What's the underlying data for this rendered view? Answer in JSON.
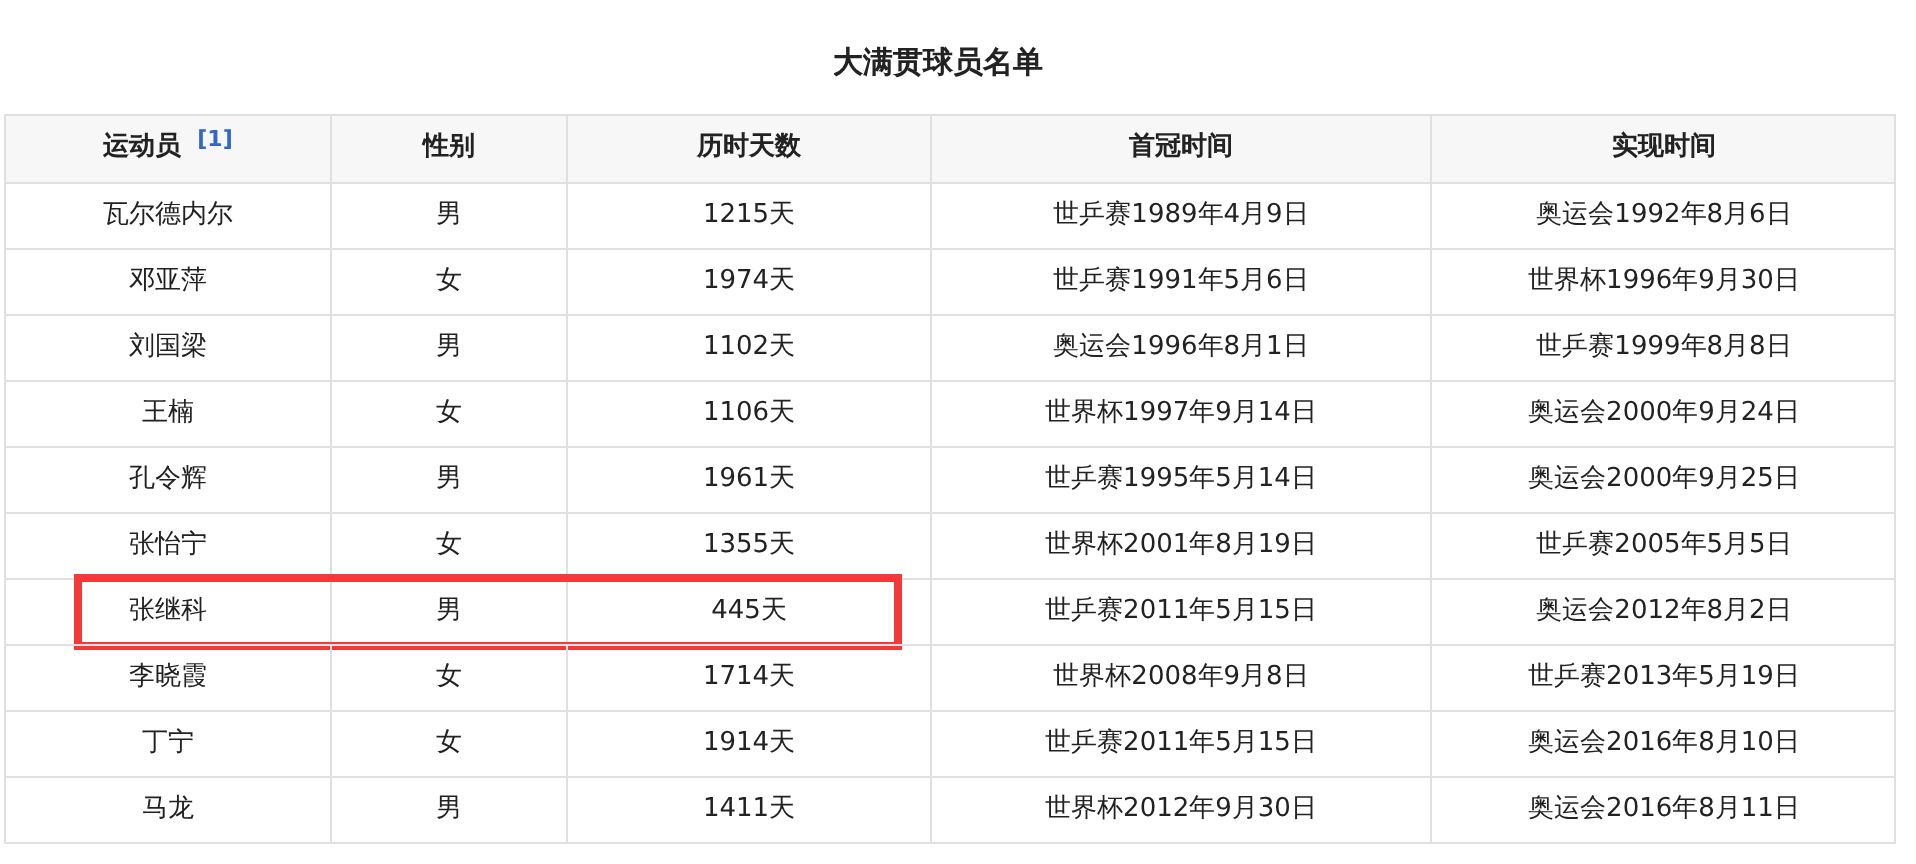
{
  "title": "大满贯球员名单",
  "table": {
    "columns": [
      {
        "label": "运动员",
        "footnote": "[1]"
      },
      {
        "label": "性别"
      },
      {
        "label": "历时天数"
      },
      {
        "label": "首冠时间"
      },
      {
        "label": "实现时间"
      }
    ],
    "rows": [
      {
        "cells": [
          "瓦尔德内尔",
          "男",
          "1215天",
          "世乒赛1989年4月9日",
          "奥运会1992年8月6日"
        ],
        "highlighted": false
      },
      {
        "cells": [
          "邓亚萍",
          "女",
          "1974天",
          "世乒赛1991年5月6日",
          "世界杯1996年9月30日"
        ],
        "highlighted": false
      },
      {
        "cells": [
          "刘国梁",
          "男",
          "1102天",
          "奥运会1996年8月1日",
          "世乒赛1999年8月8日"
        ],
        "highlighted": false
      },
      {
        "cells": [
          "王楠",
          "女",
          "1106天",
          "世界杯1997年9月14日",
          "奥运会2000年9月24日"
        ],
        "highlighted": false
      },
      {
        "cells": [
          "孔令辉",
          "男",
          "1961天",
          "世乒赛1995年5月14日",
          "奥运会2000年9月25日"
        ],
        "highlighted": false
      },
      {
        "cells": [
          "张怡宁",
          "女",
          "1355天",
          "世界杯2001年8月19日",
          "世乒赛2005年5月5日"
        ],
        "highlighted": false
      },
      {
        "cells": [
          "张继科",
          "男",
          "445天",
          "世乒赛2011年5月15日",
          "奥运会2012年8月2日"
        ],
        "highlighted": true
      },
      {
        "cells": [
          "李晓霞",
          "女",
          "1714天",
          "世界杯2008年9月8日",
          "世乒赛2013年5月19日"
        ],
        "highlighted": false
      },
      {
        "cells": [
          "丁宁",
          "女",
          "1914天",
          "世乒赛2011年5月15日",
          "奥运会2016年8月10日"
        ],
        "highlighted": false
      },
      {
        "cells": [
          "马龙",
          "男",
          "1411天",
          "世界杯2012年9月30日",
          "奥运会2016年8月11日"
        ],
        "highlighted": false
      }
    ]
  }
}
